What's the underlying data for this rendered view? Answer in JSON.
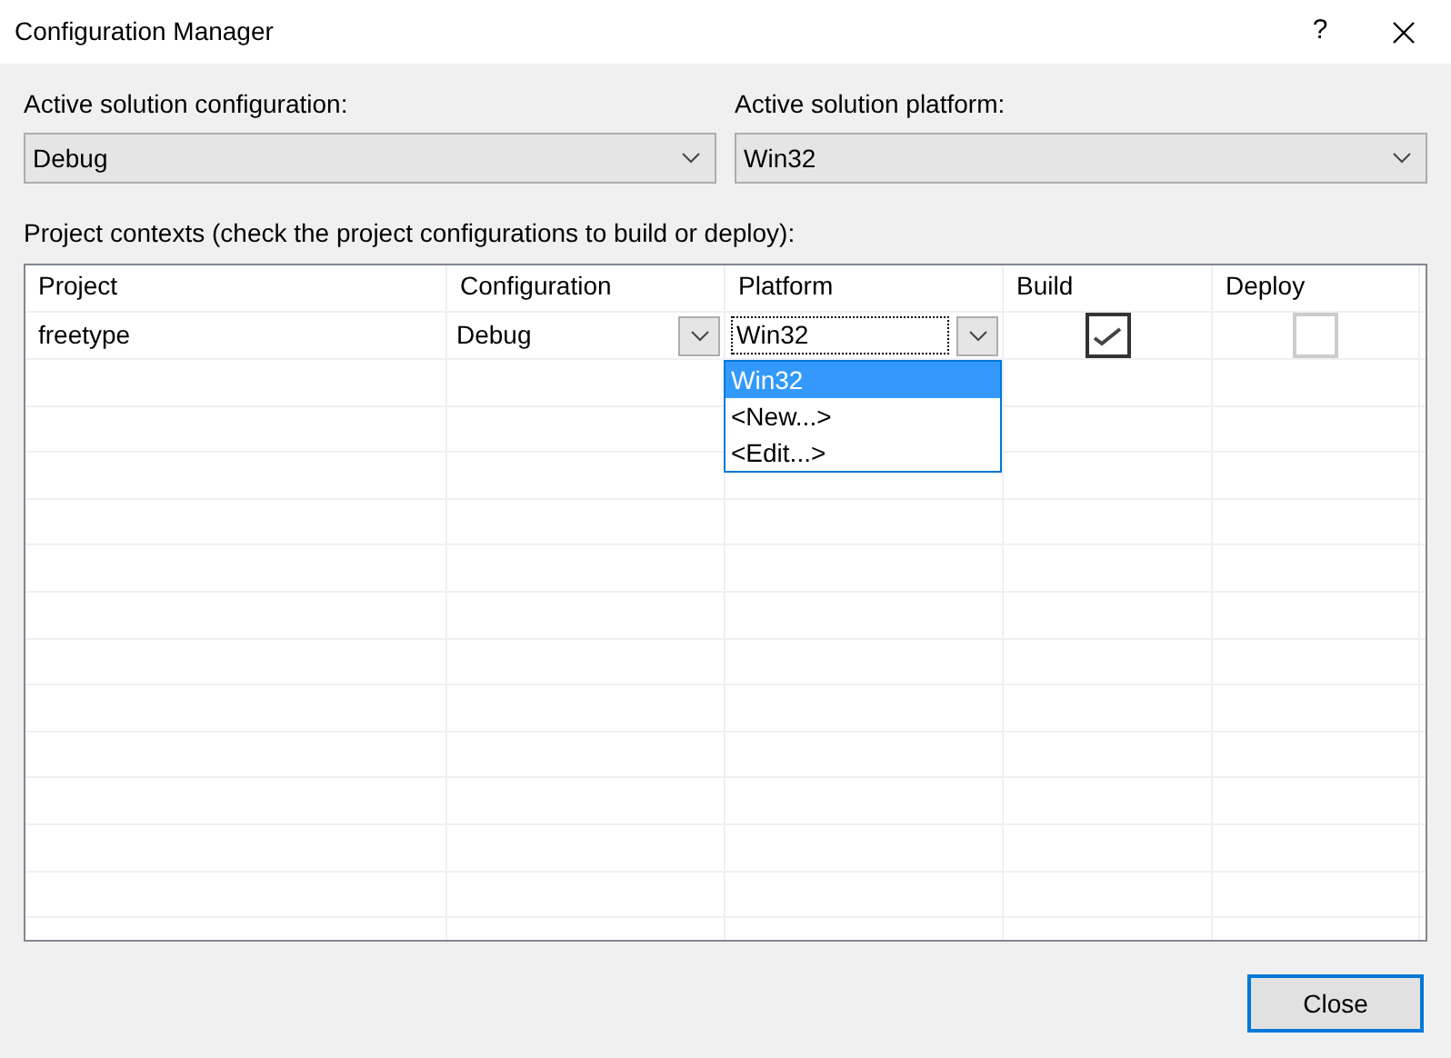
{
  "window": {
    "title": "Configuration Manager",
    "help": "?"
  },
  "solution_configuration": {
    "label": "Active solution configuration:",
    "value": "Debug"
  },
  "solution_platform": {
    "label": "Active solution platform:",
    "value": "Win32"
  },
  "contexts_label": "Project contexts (check the project configurations to build or deploy):",
  "table": {
    "columns": [
      "Project",
      "Configuration",
      "Platform",
      "Build",
      "Deploy"
    ],
    "rows": [
      {
        "project": "freetype",
        "configuration": "Debug",
        "platform": "Win32",
        "build": true,
        "deploy": false,
        "platform_options": [
          {
            "label": "Win32",
            "selected": true
          },
          {
            "label": "<New...>",
            "selected": false
          },
          {
            "label": "<Edit...>",
            "selected": false
          }
        ]
      }
    ]
  },
  "buttons": [
    "Close"
  ]
}
